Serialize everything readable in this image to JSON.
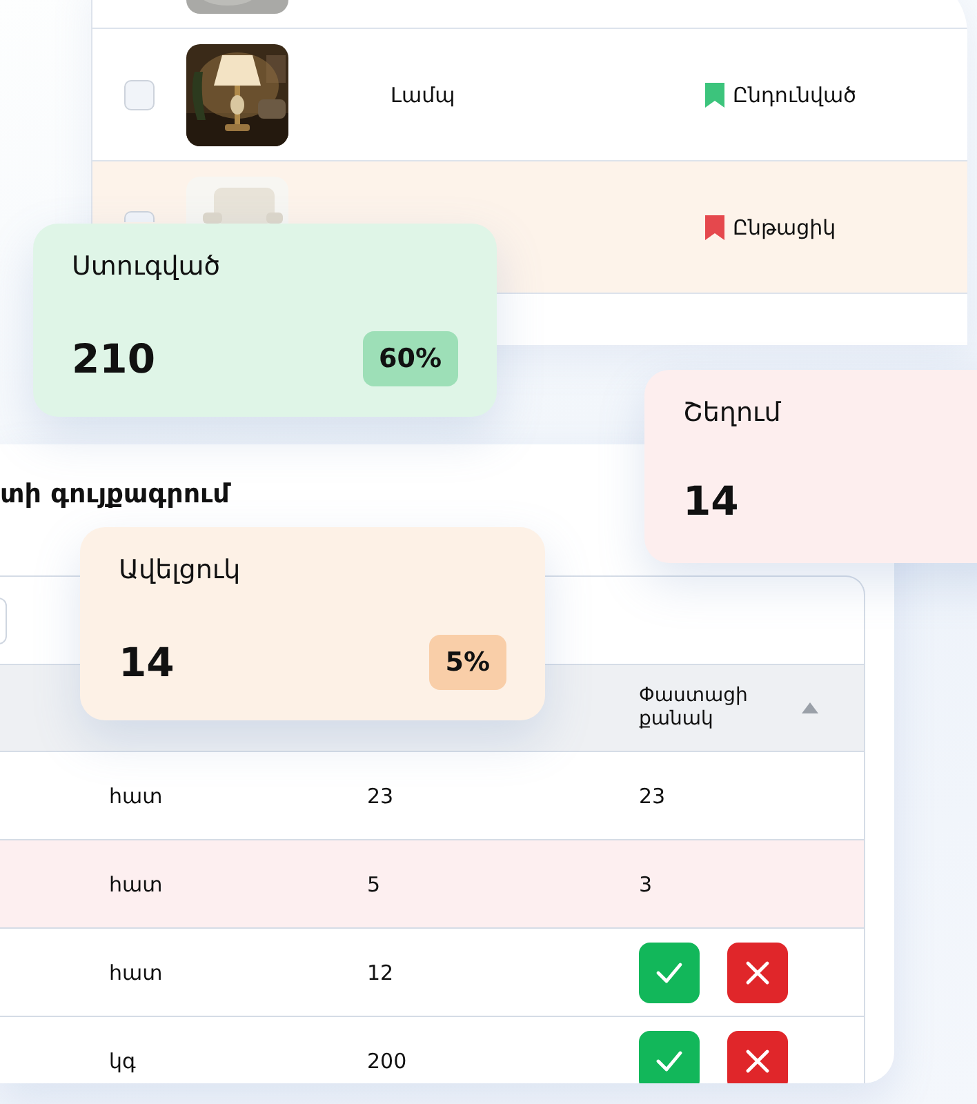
{
  "products_panel": {
    "rows": [
      {
        "kind": "cut"
      },
      {
        "kind": "full",
        "checked": false,
        "highlighted": false,
        "name": "Լամպ",
        "status": {
          "label": "Ընդունված",
          "color": "#3cc47c"
        }
      },
      {
        "kind": "covered",
        "checked": false,
        "highlighted": true,
        "status": {
          "label": "Ընթացիկ",
          "color": "#e5484d"
        }
      }
    ]
  },
  "inventory_panel": {
    "title": "տի գույքագրում",
    "columns": [
      {
        "label": "Փաստացի քանակ",
        "sorted": true
      }
    ],
    "rows": [
      {
        "kind": "value",
        "highlighted": false,
        "unit": "հատ",
        "planned": "23",
        "actual": "23"
      },
      {
        "kind": "value",
        "highlighted": true,
        "unit": "հատ",
        "planned": "5",
        "actual": "3"
      },
      {
        "kind": "review",
        "highlighted": false,
        "unit": "հատ",
        "planned": "12"
      },
      {
        "kind": "review",
        "highlighted": false,
        "unit": "կգ",
        "planned": "200"
      }
    ]
  },
  "stat_cards": [
    {
      "title": "Ստուգված",
      "value": "210",
      "badge": "60%",
      "color": "#dff5e7"
    },
    {
      "title": "Շեղում",
      "value": "14",
      "color": "#fdeeee"
    },
    {
      "title": "Ավելցուկ",
      "value": "14",
      "badge": "5%",
      "color": "#fdf1e6"
    }
  ]
}
